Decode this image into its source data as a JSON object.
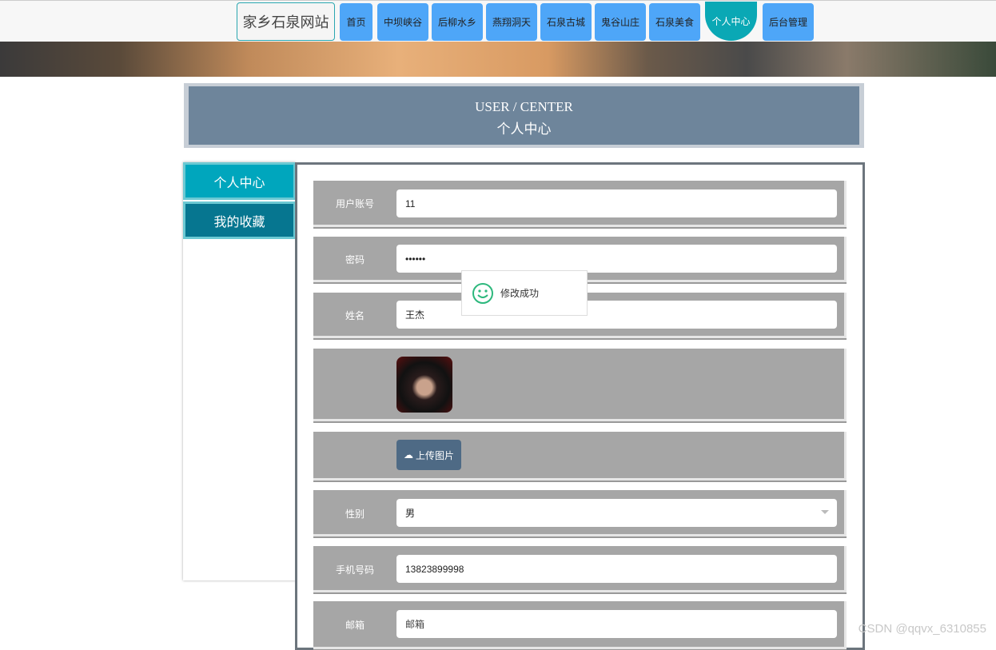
{
  "nav": {
    "brand": "家乡石泉网站",
    "items": [
      "首页",
      "中坝峡谷",
      "后柳水乡",
      "燕翔洞天",
      "石泉古城",
      "鬼谷山庄",
      "石泉美食",
      "个人中心",
      "后台管理"
    ],
    "active": "个人中心"
  },
  "header": {
    "en": "USER / CENTER",
    "zh": "个人中心"
  },
  "sidebar": {
    "items": [
      "个人中心",
      "我的收藏"
    ]
  },
  "form": {
    "account": {
      "label": "用户账号",
      "value": "11"
    },
    "password": {
      "label": "密码",
      "value": "••••••"
    },
    "name": {
      "label": "姓名",
      "value": "王杰"
    },
    "upload_label": "上传图片",
    "gender": {
      "label": "性别",
      "value": "男"
    },
    "phone": {
      "label": "手机号码",
      "value": "13823899998"
    },
    "email": {
      "label": "邮箱",
      "placeholder": "邮箱"
    }
  },
  "toast": {
    "message": "修改成功",
    "icon": "smile-icon"
  },
  "watermark": "CSDN @qqvx_6310855",
  "colors": {
    "nav": "#4ea6f8",
    "active": "#0aa8b5",
    "header": "#6e859b",
    "upload": "#4e6a85"
  }
}
